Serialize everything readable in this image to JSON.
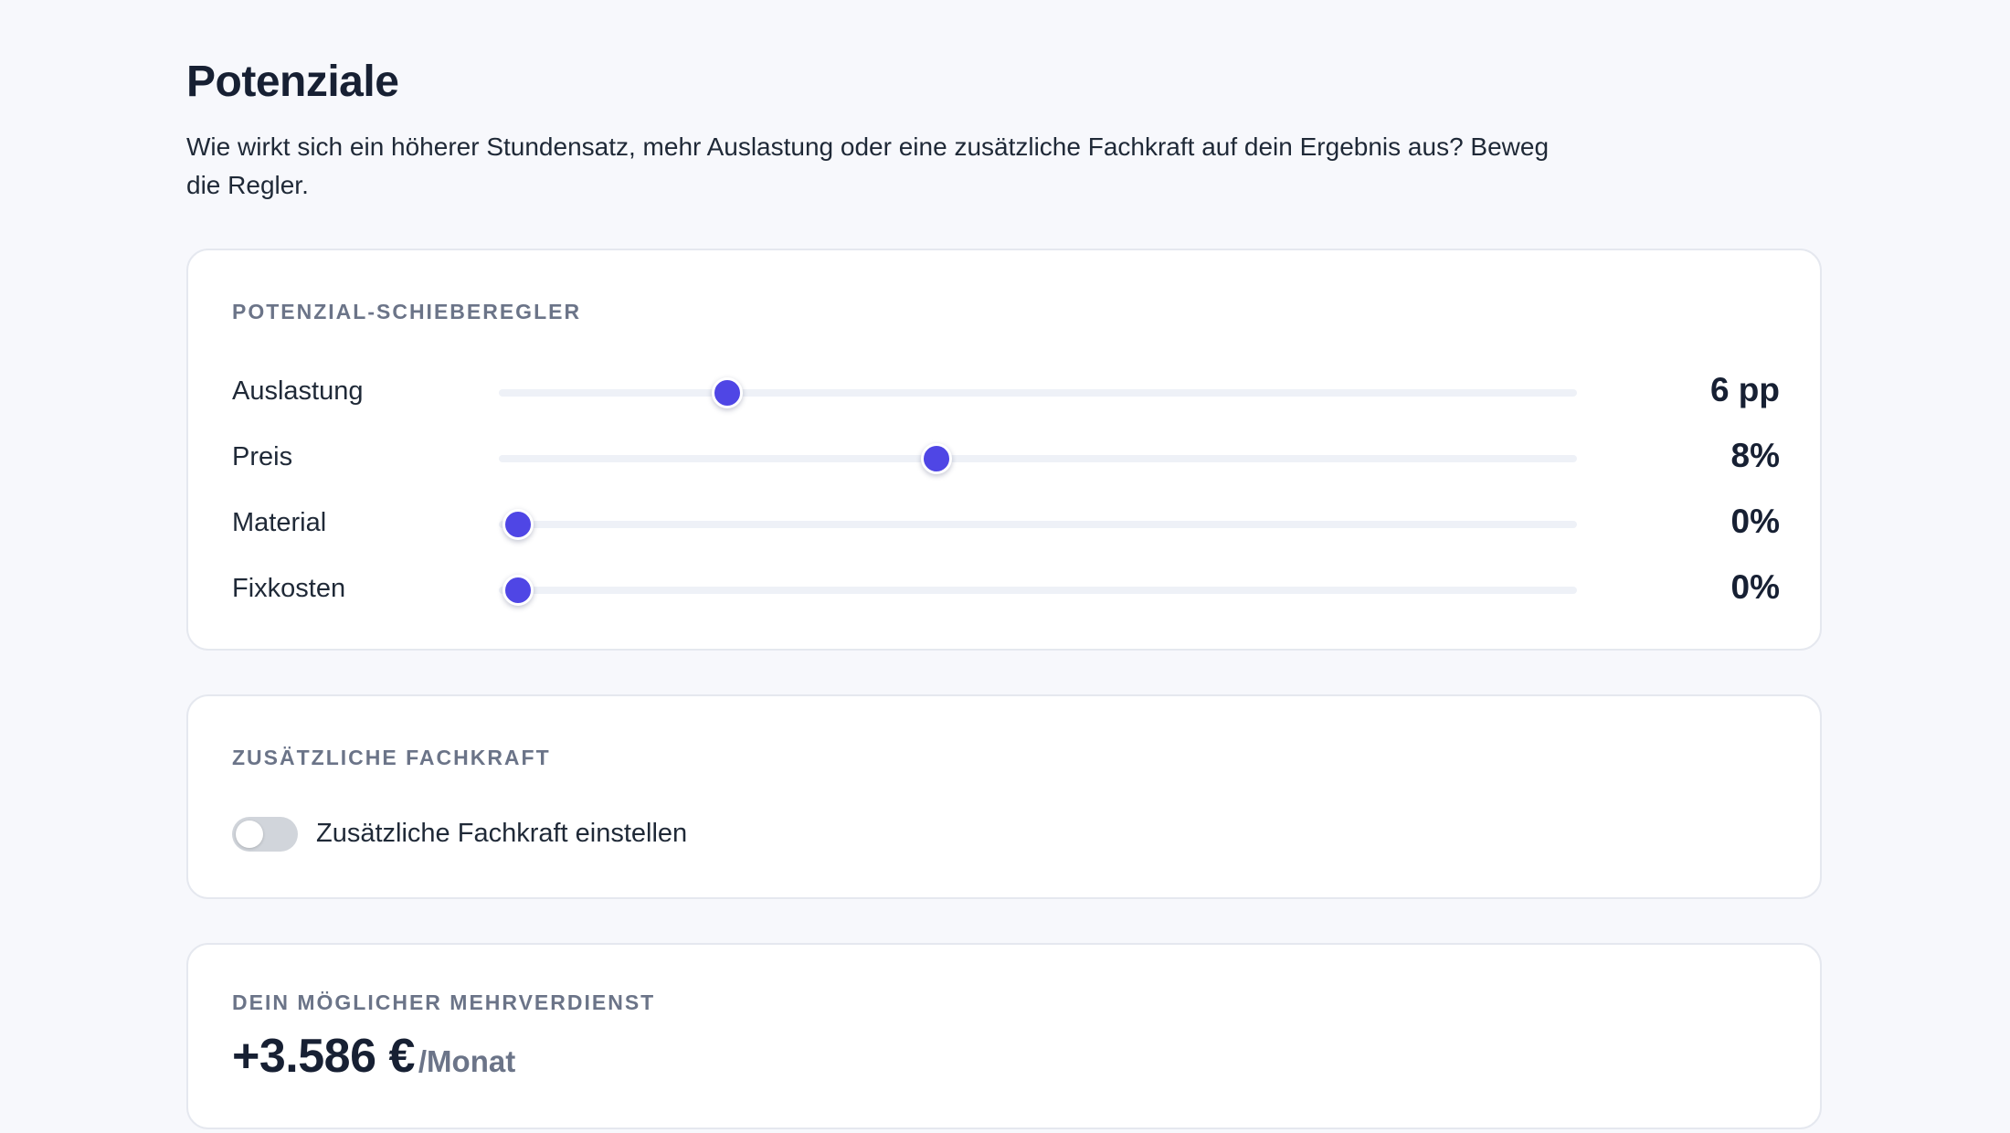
{
  "page": {
    "title": "Potenziale",
    "subtitle": "Wie wirkt sich ein höherer Stundensatz, mehr Auslastung oder eine zusätzliche Fachkraft auf dein Ergebnis aus? Beweg die Regler."
  },
  "sliders_card": {
    "heading": "POTENZIAL-SCHIEBEREGLER",
    "items": [
      {
        "label": "Auslastung",
        "value_text": "6 pp",
        "level": 0.2
      },
      {
        "label": "Preis",
        "value_text": "8%",
        "level": 0.4
      },
      {
        "label": "Material",
        "value_text": "0%",
        "level": 0
      },
      {
        "label": "Fixkosten",
        "value_text": "0%",
        "level": 0
      }
    ]
  },
  "staff_card": {
    "heading": "ZUSÄTZLICHE FACHKRAFT",
    "toggle_label": "Zusätzliche Fachkraft einstellen",
    "toggle_on": false
  },
  "result_card": {
    "heading": "DEIN MÖGLICHER MEHRVERDIENST",
    "amount": "+3.586 €",
    "unit": "/Monat"
  },
  "colors": {
    "accent": "#4f46e5",
    "background": "#f7f8fc",
    "card": "#ffffff",
    "muted_text": "#6b7488",
    "toggle_off": "#d1d5db"
  }
}
